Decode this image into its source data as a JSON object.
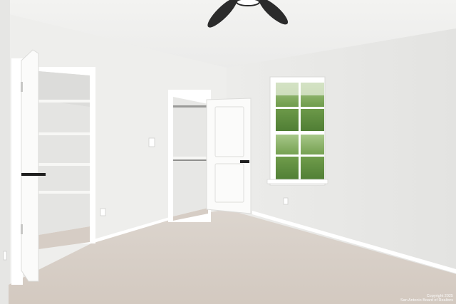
{
  "scene": {
    "subject": "empty bedroom interior",
    "colors": {
      "wall_light": "#efefed",
      "wall_shadow": "#e2e2e0",
      "ceiling": "#f1f1ef",
      "carpet": "#d9d0c8",
      "trim": "#ffffff",
      "foliage": "#6f9a4c",
      "fan_blade": "#2b2b2b"
    },
    "watermark": {
      "line1": "Copyright 2025",
      "line2": "San Antonio Board of Realtors"
    }
  }
}
